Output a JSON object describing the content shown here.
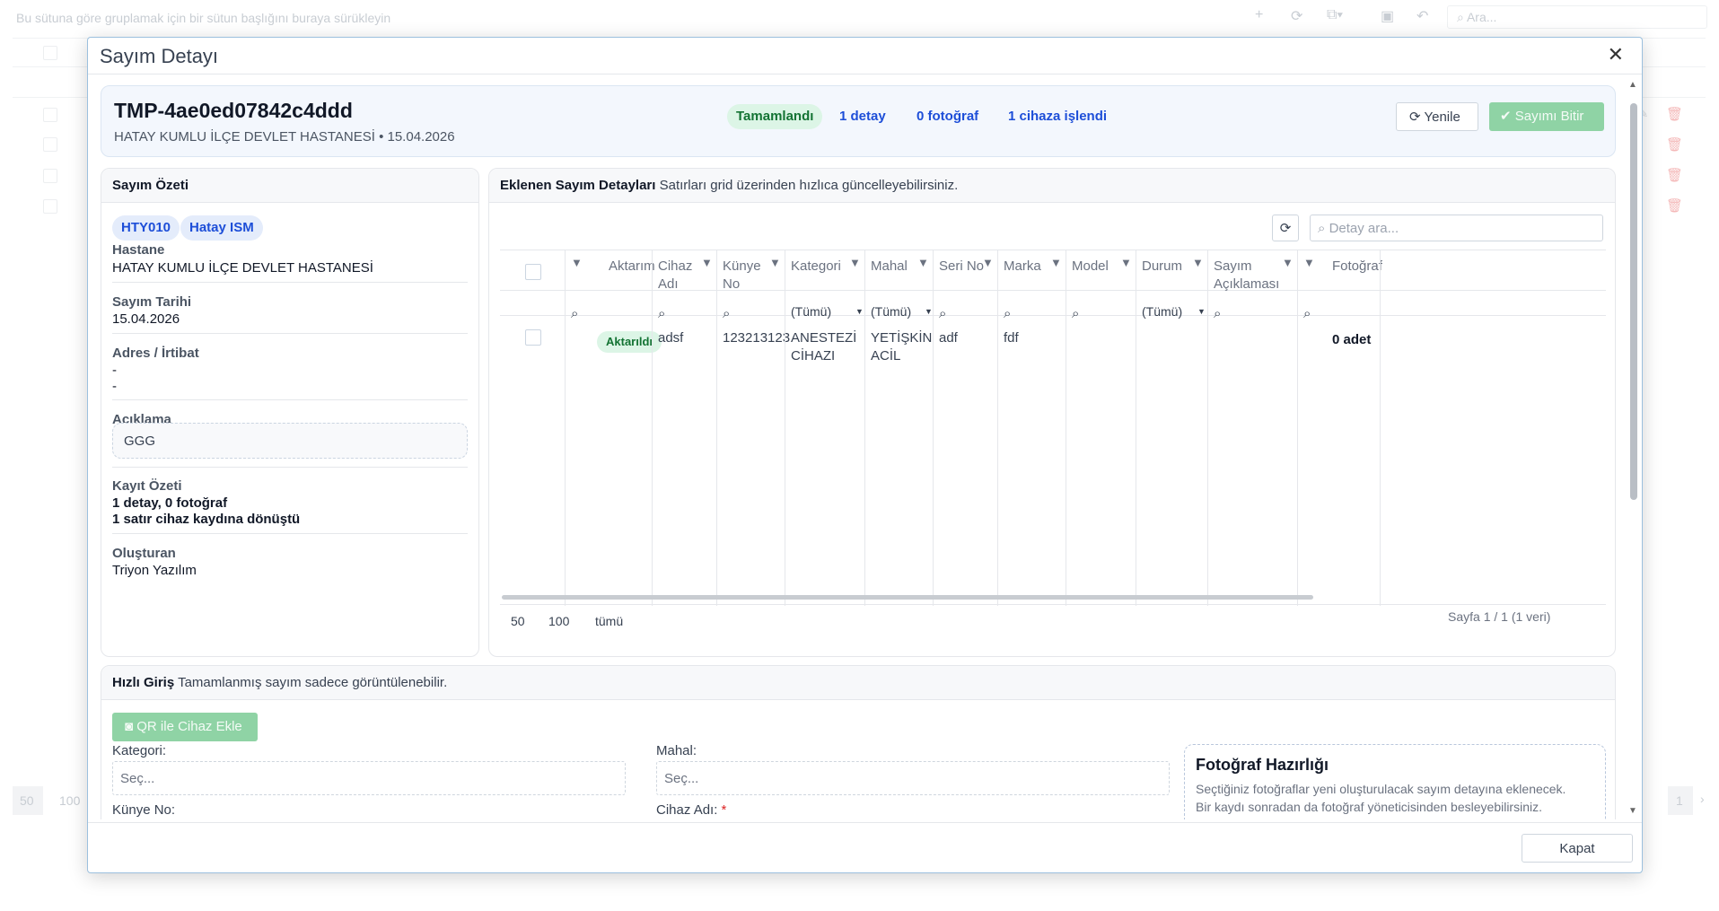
{
  "background": {
    "group_hint": "Bu sütuna göre gruplamak için bir sütun başlığını buraya sürükleyin",
    "search_placeholder": "Ara...",
    "pager_sizes": [
      "50",
      "100"
    ],
    "pager_page": "1"
  },
  "modal": {
    "title": "Sayım Detayı",
    "close_icon": "close-icon"
  },
  "header": {
    "code": "TMP-4ae0ed07842c4ddd",
    "subtitle": "HATAY KUMLU İLÇE DEVLET HASTANESİ • 15.04.2026",
    "status": "Tamamlandı",
    "detail_count": "1 detay",
    "photo_count": "0 fotoğraf",
    "device_count": "1 cihaza işlendi",
    "refresh_label": "Yenile",
    "finish_label": "Sayımı Bitir"
  },
  "summary": {
    "title": "Sayım Özeti",
    "tags": [
      "HTY010",
      "Hatay ISM"
    ],
    "hospital_label": "Hastane",
    "hospital_value": "HATAY KUMLU İLÇE DEVLET HASTANESİ",
    "date_label": "Sayım Tarihi",
    "date_value": "15.04.2026",
    "address_label": "Adres / İrtibat",
    "address_line1": "-",
    "address_line2": "-",
    "note_label": "Açıklama",
    "note_value": "GGG",
    "record_label": "Kayıt Özeti",
    "record_line1": "1 detay, 0 fotoğraf",
    "record_line2": "1 satır cihaz kaydına dönüştü",
    "creator_label": "Oluşturan",
    "creator_value": "Triyon Yazılım"
  },
  "details": {
    "title": "Eklenen Sayım Detayları",
    "subtitle": "Satırları grid üzerinden hızlıca güncelleyebilirsiniz.",
    "search_placeholder": "Detay ara...",
    "columns": {
      "aktarim": "Aktarım",
      "cihaz_adi_1": "Cihaz",
      "cihaz_adi_2": "Adı",
      "kunye_1": "Künye",
      "kunye_2": "No",
      "kategori": "Kategori",
      "mahal": "Mahal",
      "seri_no": "Seri No",
      "marka": "Marka",
      "model": "Model",
      "durum": "Durum",
      "aciklama_1": "Sayım",
      "aciklama_2": "Açıklaması",
      "fotograf": "Fotoğraf"
    },
    "filter_all": "(Tümü)",
    "rows": [
      {
        "aktarim": "Aktarıldı",
        "cihaz_adi": "adsf",
        "kunye_no": "123213123",
        "kategori_1": "ANESTEZİ",
        "kategori_2": "CİHAZI",
        "mahal_1": "YETİŞKİN",
        "mahal_2": "ACİL",
        "seri_no": "adf",
        "marka": "fdf",
        "fotograf": "0 adet"
      }
    ],
    "page_sizes": [
      "50",
      "100",
      "tümü"
    ],
    "page_info": "Sayfa 1 / 1 (1 veri)"
  },
  "quick": {
    "title": "Hızlı Giriş",
    "subtitle": "Tamamlanmış sayım sadece görüntülenebilir.",
    "qr_label": "QR ile Cihaz Ekle",
    "kategori_label": "Kategori:",
    "kategori_placeholder": "Seç...",
    "mahal_label": "Mahal:",
    "mahal_placeholder": "Seç...",
    "kunye_label": "Künye No:",
    "cihaz_label": "Cihaz Adı:",
    "required_mark": "*",
    "photo_title": "Fotoğraf Hazırlığı",
    "photo_desc_1": "Seçtiğiniz fotoğraflar yeni oluşturulacak sayım detayına eklenecek.",
    "photo_desc_2": "Bir kaydı sonradan da fotoğraf yöneticisinden besleyebilirsiniz."
  },
  "footer": {
    "close_label": "Kapat"
  },
  "colors": {
    "accent_blue": "#1d4ed8",
    "success_green": "#137333",
    "success_bg": "#dcf5e6",
    "disabled_green": "#8fd3a5"
  }
}
